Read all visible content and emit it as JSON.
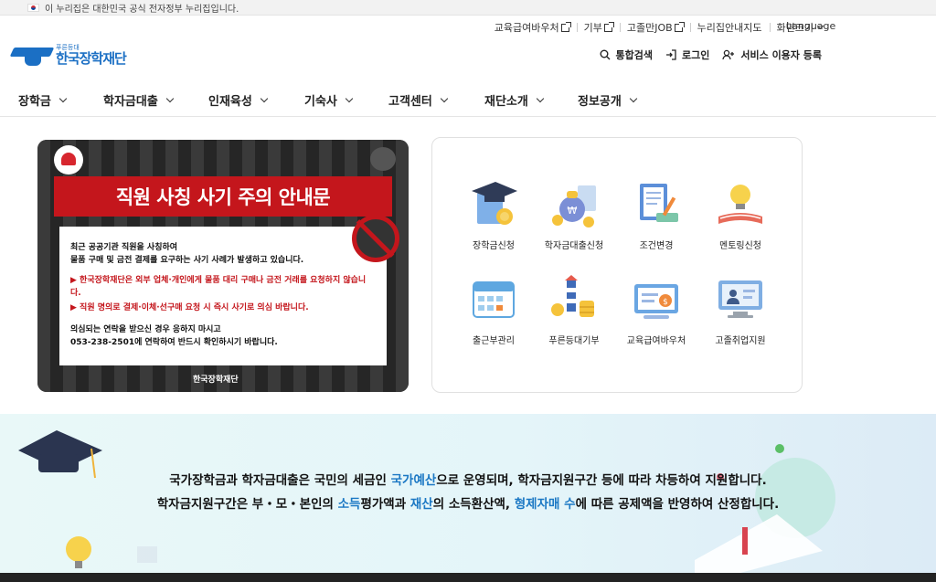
{
  "gov_banner": {
    "text": "이 누리집은 대한민국 공식 전자정부 누리집입니다."
  },
  "utility": {
    "items": [
      "교육급여바우처",
      "기부",
      "고졸만JOB",
      "누리집안내지도",
      "화면크기"
    ],
    "language": "Language"
  },
  "logo": {
    "sub": "푸른등대",
    "name": "한국장학재단"
  },
  "actions": {
    "search": "통합검색",
    "login": "로그인",
    "register": "서비스 이용자 등록"
  },
  "gnb": [
    "장학금",
    "학자금대출",
    "인재육성",
    "기숙사",
    "고객센터",
    "재단소개",
    "정보공개"
  ],
  "banner": {
    "title": "직원 사칭 사기 주의 안내문",
    "p1_line1": "최근 공공기관 직원을 사칭하여",
    "p1_line2": "물품 구매 및 금전 결제를 요구하는 사기 사례가 발생하고 있습니다.",
    "warn1": "▶ 한국장학재단은 외부 업체·개인에게 물품 대리 구매나 금전 거래를 요청하지 않습니다.",
    "warn2": "▶ 직원 명의로 결제·이체·선구매 요청 시 즉시 사기로 의심 바랍니다.",
    "p2_line1": "의심되는 연락을 받으신 경우 응하지 마시고",
    "p2_line2": "053-238-2501에 연락하여 반드시 확인하시기 바랍니다.",
    "footer_logo": "한국장학재단"
  },
  "quick": [
    {
      "label": "장학금신청",
      "icon": "graduation-cap-icon"
    },
    {
      "label": "학자금대출신청",
      "icon": "money-bag-icon"
    },
    {
      "label": "조건변경",
      "icon": "document-edit-icon"
    },
    {
      "label": "멘토링신청",
      "icon": "lightbulb-book-icon"
    },
    {
      "label": "출근부관리",
      "icon": "calendar-icon"
    },
    {
      "label": "푸른등대기부",
      "icon": "lighthouse-coins-icon"
    },
    {
      "label": "교육급여바우처",
      "icon": "voucher-card-icon"
    },
    {
      "label": "고졸취업지원",
      "icon": "monitor-person-icon"
    }
  ],
  "info": {
    "l1_a": "국가장학금과 학자금대출은 국민의 세금인 ",
    "l1_hl": "국가예산",
    "l1_b": "으로 운영되며, 학자금지원구간 등에 따라 차등하여 지원합니다.",
    "l2_a": "학자금지원구간은 부・모・본인의 ",
    "l2_hl1": "소득",
    "l2_b": "평가액과 ",
    "l2_hl2": "재산",
    "l2_c": "의 소득환산액, ",
    "l2_hl3": "형제자매 수",
    "l2_d": "에 따른 공제액을 반영하여 산정합니다."
  }
}
